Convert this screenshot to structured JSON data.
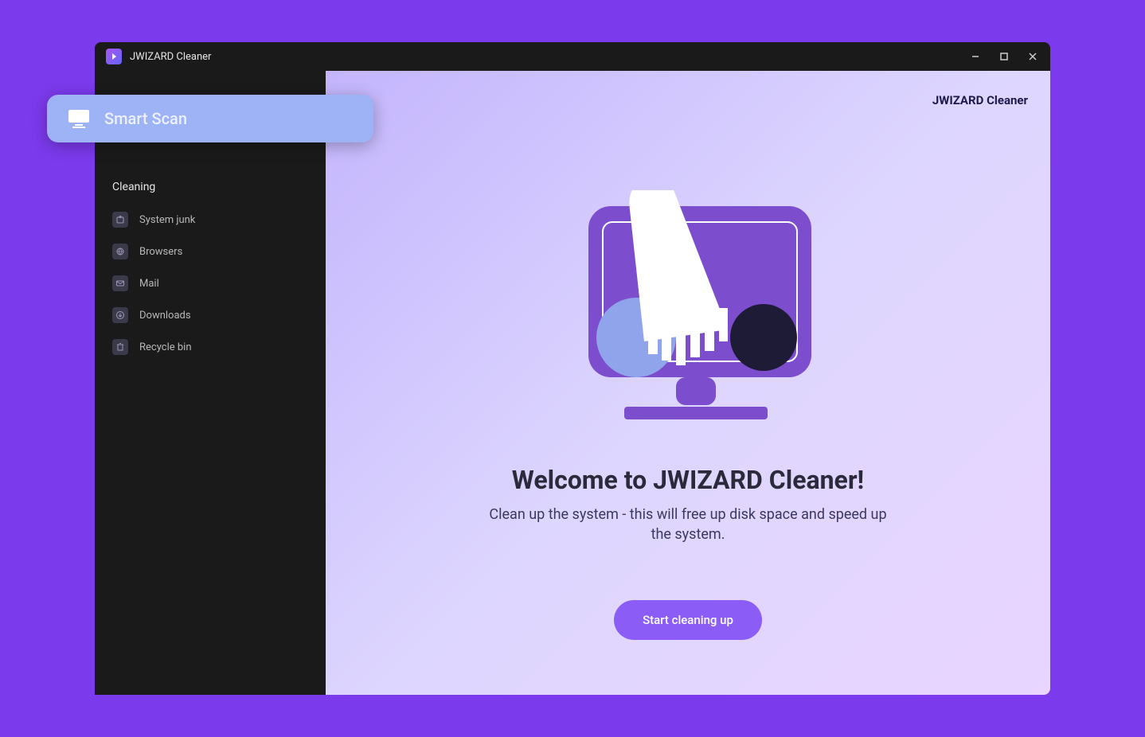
{
  "titlebar": {
    "app_name": "JWIZARD Cleaner"
  },
  "sidebar": {
    "smart_scan_label": "Smart Scan",
    "section_header": "Cleaning",
    "items": [
      {
        "label": "System junk",
        "icon": "folder-icon"
      },
      {
        "label": "Browsers",
        "icon": "globe-icon"
      },
      {
        "label": "Mail",
        "icon": "mail-icon"
      },
      {
        "label": "Downloads",
        "icon": "download-icon"
      },
      {
        "label": "Recycle bin",
        "icon": "trash-icon"
      }
    ]
  },
  "main": {
    "brand": "JWIZARD Cleaner",
    "welcome_title": "Welcome to JWIZARD Cleaner!",
    "welcome_subtitle": "Clean up the system - this will free up disk space and speed up the system.",
    "start_button": "Start cleaning up"
  }
}
